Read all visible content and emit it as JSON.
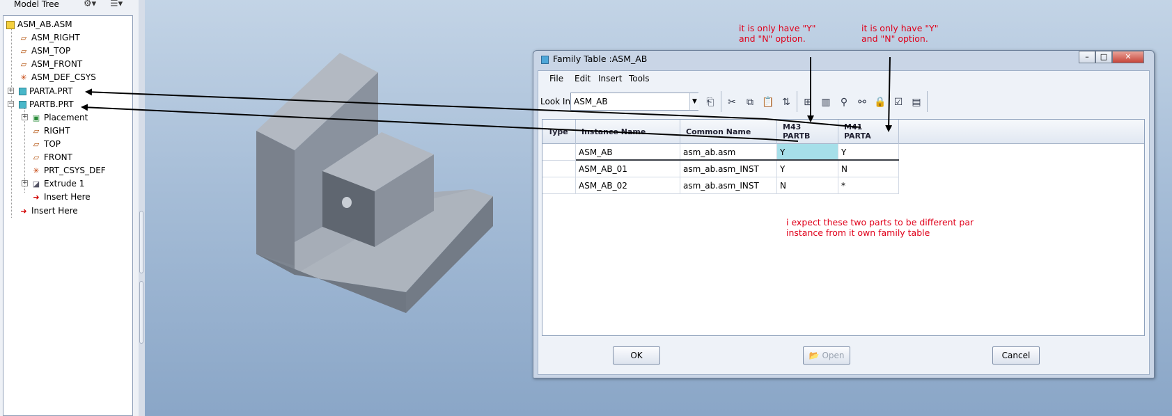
{
  "model_tree": {
    "title": "Model Tree",
    "settings_icon": "tree-filter-icon",
    "show_icon": "tree-columns-icon",
    "items": [
      {
        "label": "ASM_AB.ASM",
        "icon": "assembly-icon"
      },
      {
        "label": "ASM_RIGHT",
        "icon": "datum-plane-icon"
      },
      {
        "label": "ASM_TOP",
        "icon": "datum-plane-icon"
      },
      {
        "label": "ASM_FRONT",
        "icon": "datum-plane-icon"
      },
      {
        "label": "ASM_DEF_CSYS",
        "icon": "csys-icon"
      },
      {
        "label": "PARTA.PRT",
        "icon": "part-icon"
      },
      {
        "label": "PARTB.PRT",
        "icon": "part-icon"
      },
      {
        "label": "Placement",
        "icon": "placement-icon"
      },
      {
        "label": "RIGHT",
        "icon": "datum-plane-icon"
      },
      {
        "label": "TOP",
        "icon": "datum-plane-icon"
      },
      {
        "label": "FRONT",
        "icon": "datum-plane-icon"
      },
      {
        "label": "PRT_CSYS_DEF",
        "icon": "csys-icon"
      },
      {
        "label": "Extrude 1",
        "icon": "extrude-icon"
      },
      {
        "label": "Insert Here",
        "icon": "insert-here-icon"
      },
      {
        "label": "Insert Here",
        "icon": "insert-here-icon"
      }
    ]
  },
  "dialog": {
    "title": "Family Table :ASM_AB",
    "menu": [
      "File",
      "Edit",
      "Insert",
      "Tools"
    ],
    "look_in_label": "Look In:",
    "look_in_value": "ASM_AB",
    "columns": [
      {
        "line1": "Type",
        "line2": ""
      },
      {
        "line1": "Instance Name",
        "line2": ""
      },
      {
        "line1": "Common Name",
        "line2": ""
      },
      {
        "line1": "M43",
        "line2": "PARTB"
      },
      {
        "line1": "M41",
        "line2": "PARTA"
      }
    ],
    "rows": [
      {
        "type": "",
        "instance": "ASM_AB",
        "common": "asm_ab.asm",
        "m43": "Y",
        "m41": "Y"
      },
      {
        "type": "",
        "instance": "ASM_AB_01",
        "common": "asm_ab.asm_INST",
        "m43": "Y",
        "m41": "N"
      },
      {
        "type": "",
        "instance": "ASM_AB_02",
        "common": "asm_ab.asm_INST",
        "m43": "N",
        "m41": "*"
      }
    ],
    "buttons": {
      "ok": "OK",
      "open": "Open",
      "cancel": "Cancel"
    }
  },
  "annotations": {
    "note1": "it is only have \"Y\"\nand \"N\" option.",
    "note2": "it is only have \"Y\"\nand \"N\" option.",
    "note3": "i expect these two parts to be different par\ninstance from it own family table",
    "color": "#e0001a"
  }
}
